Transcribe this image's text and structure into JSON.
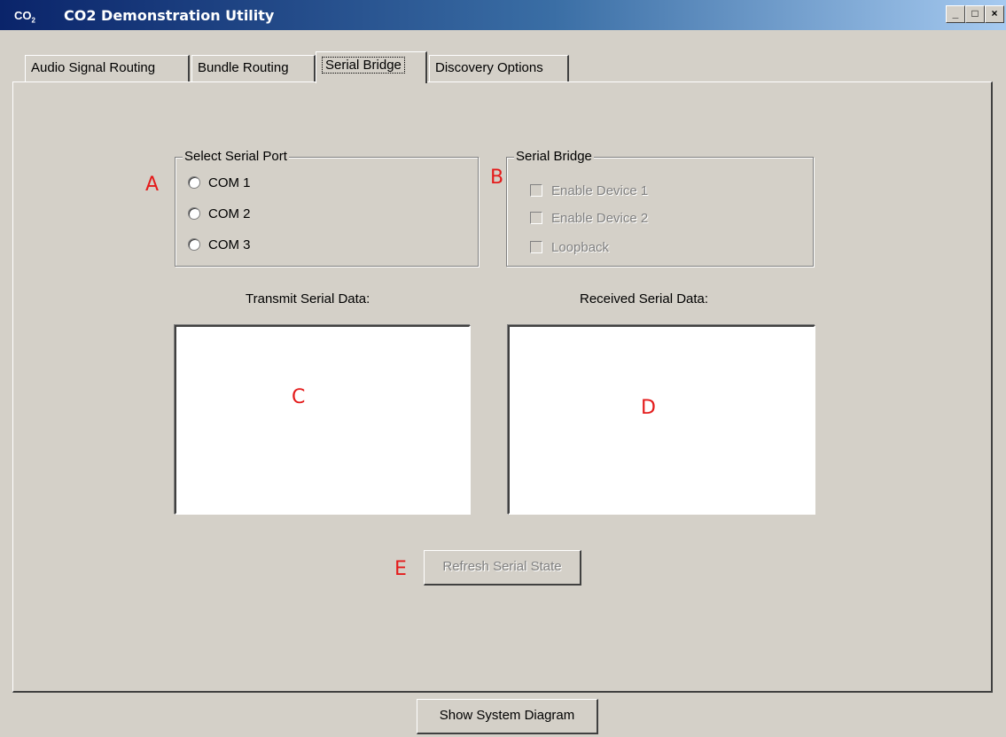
{
  "window": {
    "title": "CO2 Demonstration Utility",
    "icon_label": "CO",
    "icon_sub": "2",
    "buttons": {
      "minimize": "_",
      "maximize": "□",
      "close": "×"
    }
  },
  "tabs": [
    {
      "label": "Audio Signal Routing",
      "active": false
    },
    {
      "label": "Bundle Routing",
      "active": false
    },
    {
      "label": "Serial Bridge",
      "active": true
    },
    {
      "label": "Discovery Options",
      "active": false
    }
  ],
  "serial_port_group": {
    "title": "Select Serial Port",
    "options": [
      {
        "label": "COM 1",
        "selected": false
      },
      {
        "label": "COM 2",
        "selected": false
      },
      {
        "label": "COM 3",
        "selected": false
      }
    ]
  },
  "serial_bridge_group": {
    "title": "Serial Bridge",
    "options": [
      {
        "label": "Enable Device 1",
        "checked": false,
        "enabled": false
      },
      {
        "label": "Enable Device 2",
        "checked": false,
        "enabled": false
      },
      {
        "label": "Loopback",
        "checked": false,
        "enabled": false
      }
    ]
  },
  "transmit": {
    "label": "Transmit Serial Data:",
    "value": ""
  },
  "received": {
    "label": "Received Serial Data:",
    "value": ""
  },
  "refresh_button": {
    "label": "Refresh Serial State",
    "enabled": false
  },
  "show_diagram_button": {
    "label": "Show System Diagram"
  },
  "annotations": {
    "a": "A",
    "b": "B",
    "c": "C",
    "d": "D",
    "e": "E"
  },
  "colors": {
    "annotation": "#e41b1b",
    "face": "#d4d0c8",
    "title_start": "#0a246a",
    "title_end": "#a6caf0"
  }
}
